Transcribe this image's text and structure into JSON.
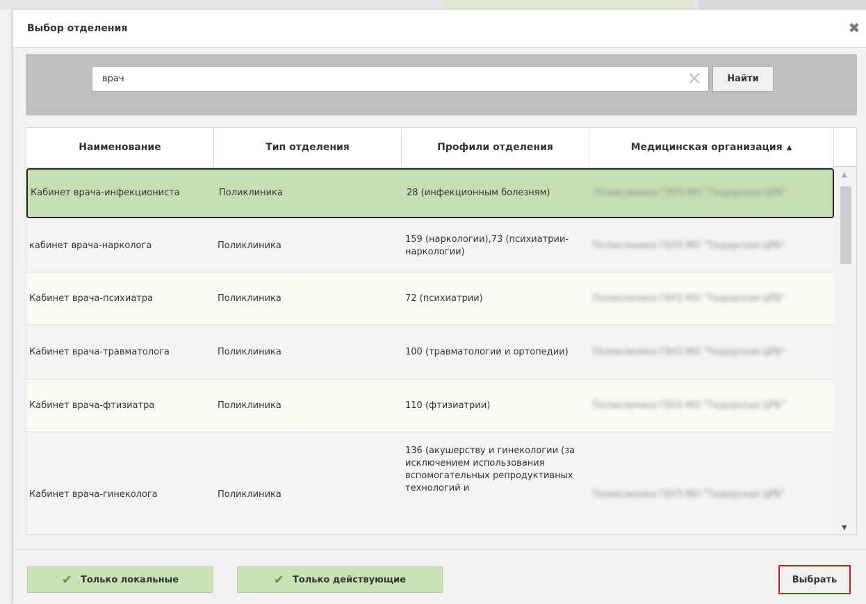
{
  "dialog": {
    "title": "Выбор отделения",
    "close_icon": "close-icon"
  },
  "search": {
    "value": "врач",
    "button_label": "Найти",
    "clear_icon": "clear-icon"
  },
  "table": {
    "columns": [
      {
        "label": "Наименование"
      },
      {
        "label": "Тип отделения"
      },
      {
        "label": "Профили отделения"
      },
      {
        "label": "Медицинская организация",
        "sort": "ascending"
      }
    ],
    "rows": [
      {
        "name": "Кабинет врача-инфекциониста",
        "type": "Поликлиника",
        "profiles": "28 (инфекционным болезням)",
        "organization": "Поликлиника ГБУЗ МО \"Тюдорская ЦРБ\"",
        "selected": true
      },
      {
        "name": "кабинет врача-нарколога",
        "type": "Поликлиника",
        "profiles": "159 (наркологии),73 (психиатрии-наркологии)",
        "organization": "Поликлиника ГБУЗ МО \"Тюдорская ЦРБ\""
      },
      {
        "name": "Кабинет врача-психиатра",
        "type": "Поликлиника",
        "profiles": "72 (психиатрии)",
        "organization": "Поликлиника ГБУЗ МО \"Тюдорская ЦРБ\""
      },
      {
        "name": "Кабинет врача-травматолога",
        "type": "Поликлиника",
        "profiles": "100 (травматологии и ортопедии)",
        "organization": "Поликлиника ГБУЗ МО \"Тюдорская ЦРБ\""
      },
      {
        "name": "Кабинет врача-фтизиатра",
        "type": "Поликлиника",
        "profiles": "110 (фтизиатрии)",
        "organization": "Поликлиника ГБУЗ МО \"Тюдорская ЦРБ\""
      },
      {
        "name": "Кабинет врача-гинеколога",
        "type": "Поликлиника",
        "profiles": "136 (акушерству и гинекологии (за исключением использования вспомогательных репродуктивных технологий и",
        "organization": "Поликлиника ГБУЗ МО \"Тюдорская ЦРБ\""
      }
    ]
  },
  "footer": {
    "local_only_label": "Только локальные",
    "active_only_label": "Только действующие",
    "select_label": "Выбрать"
  },
  "colors": {
    "selected_row": "#c6dfb2",
    "green_button": "#c9e2b6",
    "select_border": "#c41e1e"
  }
}
